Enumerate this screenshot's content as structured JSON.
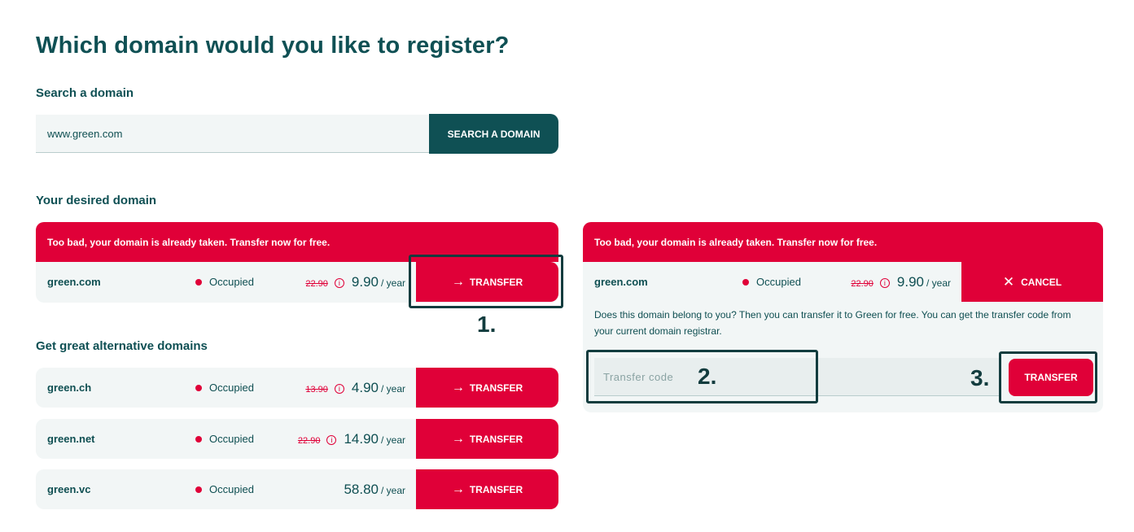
{
  "page": {
    "title": "Which domain would you like to register?",
    "search_heading": "Search a domain",
    "search_value": "www.green.com",
    "search_button": "SEARCH A DOMAIN",
    "desired_heading": "Your desired domain",
    "alternatives_heading": "Get great alternative domains"
  },
  "desired": {
    "banner": "Too bad, your domain is already taken. Transfer now for free.",
    "name": "green.com",
    "status": "Occupied",
    "old_price": "22.90",
    "price": "9.90",
    "per": "/ year",
    "button": "TRANSFER"
  },
  "alternatives": [
    {
      "name": "green.ch",
      "status": "Occupied",
      "old_price": "13.90",
      "price": "4.90",
      "per": "/ year",
      "button": "TRANSFER"
    },
    {
      "name": "green.net",
      "status": "Occupied",
      "old_price": "22.90",
      "price": "14.90",
      "per": "/ year",
      "button": "TRANSFER"
    },
    {
      "name": "green.vc",
      "status": "Occupied",
      "old_price": "",
      "price": "58.80",
      "per": "/ year",
      "button": "TRANSFER"
    }
  ],
  "transfer_panel": {
    "banner": "Too bad, your domain is already taken. Transfer now for free.",
    "name": "green.com",
    "status": "Occupied",
    "old_price": "22.90",
    "price": "9.90",
    "per": "/ year",
    "cancel": "CANCEL",
    "description": "Does this domain belong to you? Then you can transfer it to Green for free. You can get the transfer code from your current domain registrar.",
    "code_placeholder": "Transfer code",
    "button": "TRANSFER"
  },
  "annotations": [
    "1.",
    "2.",
    "3."
  ],
  "colors": {
    "brand_red": "#e00038",
    "brand_teal": "#0f5054",
    "annotation": "#123c3e"
  },
  "icons": {
    "arrow": "arrow-right-icon",
    "info": "info-icon",
    "close": "close-icon"
  }
}
